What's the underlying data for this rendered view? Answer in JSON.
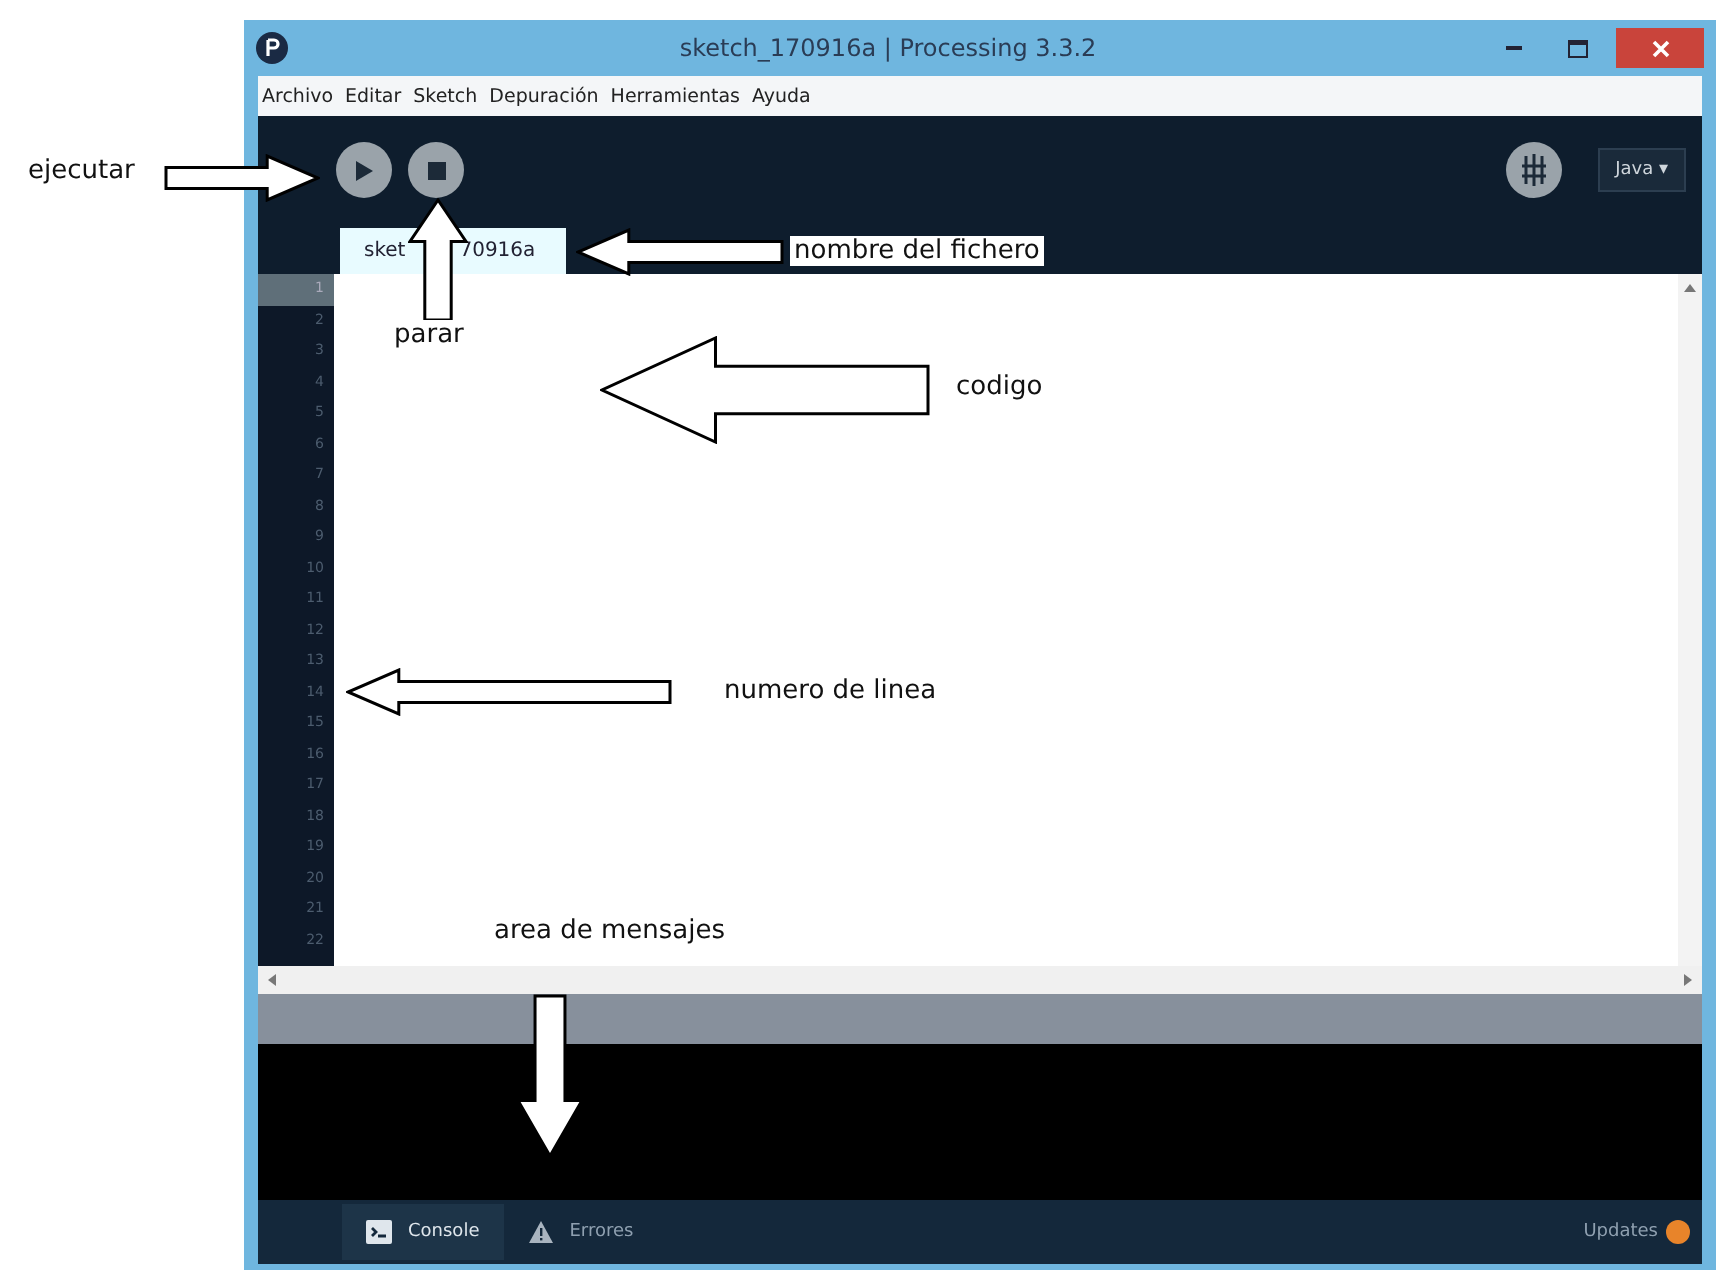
{
  "window": {
    "title": "sketch_170916a | Processing 3.3.2"
  },
  "menu": [
    "Archivo",
    "Editar",
    "Sketch",
    "Depuración",
    "Herramientas",
    "Ayuda"
  ],
  "toolbar": {
    "mode": "Java ▾"
  },
  "tab": {
    "label_parts": [
      "sket",
      "70916a"
    ]
  },
  "editor": {
    "lines": [
      {
        "number": "1",
        "selected": true
      },
      {
        "number": "2",
        "selected": false
      },
      {
        "number": "3",
        "selected": false
      },
      {
        "number": "4",
        "selected": false
      },
      {
        "number": "5",
        "selected": false
      },
      {
        "number": "6",
        "selected": false
      },
      {
        "number": "7",
        "selected": false
      },
      {
        "number": "8",
        "selected": false
      },
      {
        "number": "9",
        "selected": false
      },
      {
        "number": "10",
        "selected": false
      },
      {
        "number": "11",
        "selected": false
      },
      {
        "number": "12",
        "selected": false
      },
      {
        "number": "13",
        "selected": false
      },
      {
        "number": "14",
        "selected": false
      },
      {
        "number": "15",
        "selected": false
      },
      {
        "number": "16",
        "selected": false
      },
      {
        "number": "17",
        "selected": false
      },
      {
        "number": "18",
        "selected": false
      },
      {
        "number": "19",
        "selected": false
      },
      {
        "number": "20",
        "selected": false
      },
      {
        "number": "21",
        "selected": false
      },
      {
        "number": "22",
        "selected": false
      }
    ]
  },
  "footer": {
    "tabs": [
      {
        "label": "Console",
        "kind": "console",
        "selected": true
      },
      {
        "label": "Errores",
        "kind": "errors",
        "selected": false
      }
    ],
    "updates": "Updates"
  },
  "annotations": [
    {
      "label": "ejecutar",
      "kind": "right"
    },
    {
      "label": "parar",
      "kind": "up"
    },
    {
      "label": "nombre del fichero",
      "kind": "left"
    },
    {
      "label": "codigo",
      "kind": "left"
    },
    {
      "label": "numero de linea",
      "kind": "left"
    },
    {
      "label": "area de mensajes",
      "kind": "down"
    }
  ]
}
